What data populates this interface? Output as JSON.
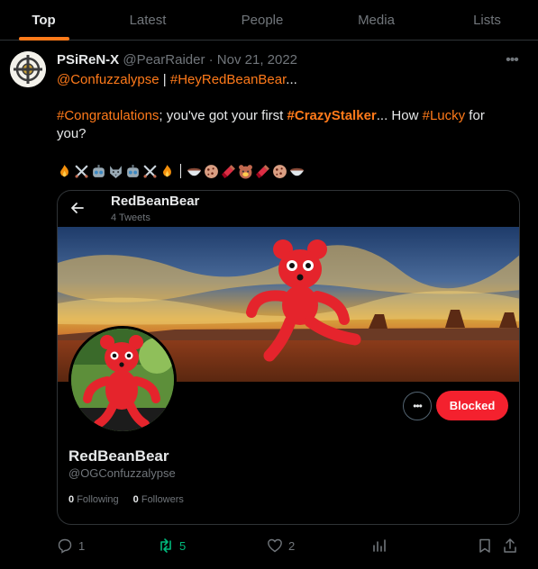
{
  "tabs": [
    {
      "label": "Top",
      "active": true
    },
    {
      "label": "Latest"
    },
    {
      "label": "People"
    },
    {
      "label": "Media"
    },
    {
      "label": "Lists"
    }
  ],
  "tweet": {
    "display_name": "PSiReN-X",
    "meta": "@PearRaider · Nov 21, 2022",
    "line1": {
      "mention": "@Confuzzalypse",
      "separator": " | ",
      "hashtag": "#HeyRedBeanBear",
      "suffix": "..."
    },
    "line2": {
      "tag1": "#Congratulations",
      "text1": "; you've got your first ",
      "tag2": "#CrazyStalker",
      "text2": "... How ",
      "tag3": "#Lucky",
      "text3": " for you?"
    },
    "emojis_left": [
      "fire-emoji",
      "crossed-swords-emoji",
      "robot-emoji",
      "wolf-emoji",
      "robot-emoji",
      "crossed-swords-emoji",
      "fire-emoji"
    ],
    "emoji_separator": "|",
    "emojis_right": [
      "bowl-emoji",
      "cookie-emoji",
      "chocolate-emoji",
      "bear-emoji",
      "chocolate-emoji",
      "cookie-emoji",
      "bowl-emoji"
    ]
  },
  "card": {
    "name": "RedBeanBear",
    "tweets_count": "4 Tweets",
    "profile_name": "RedBeanBear",
    "handle": "@OGConfuzzalypse",
    "following_count": "0",
    "following_label": "Following",
    "followers_count": "0",
    "followers_label": "Followers",
    "blocked_label": "Blocked"
  },
  "actions": {
    "replies": "1",
    "retweets": "5",
    "likes": "2"
  },
  "colors": {
    "accent": "#ff7a1a",
    "blocked": "#f4212e",
    "retweet": "#00ba7c",
    "muted": "#71767b"
  }
}
